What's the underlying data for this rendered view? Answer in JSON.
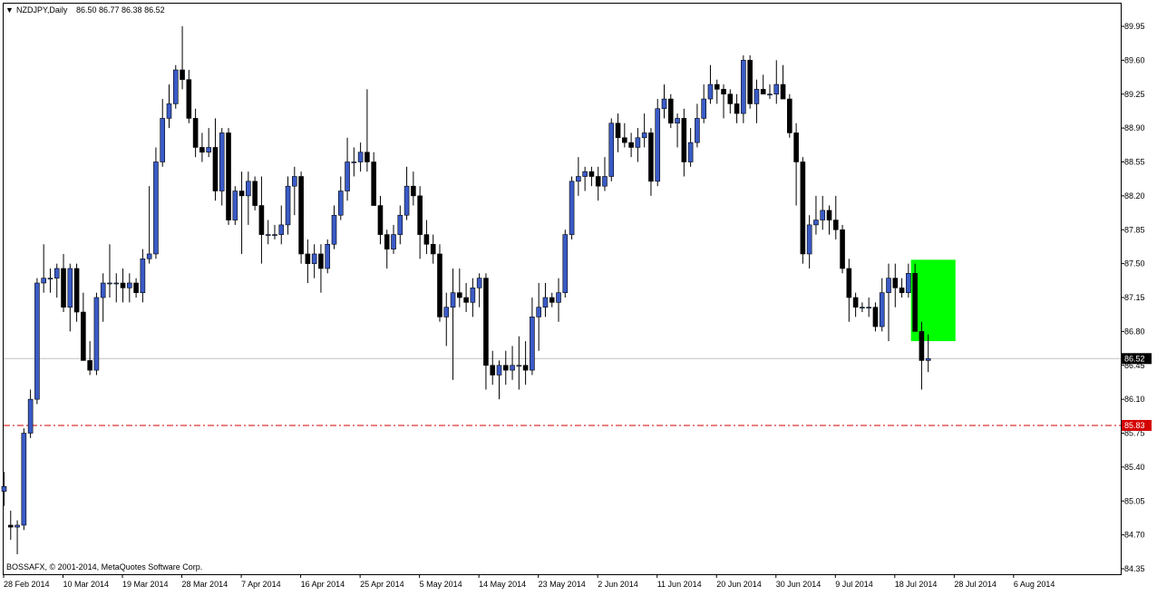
{
  "header": {
    "marker": "▼",
    "symbol_label": "NZDJPY,Daily",
    "ohlc_text": "86.50 86.77 86.38 86.52"
  },
  "footer": {
    "copyright": "BOSSAFX, © 2001-2014, MetaQuotes Software Corp."
  },
  "colors": {
    "bull": "#3a5bc7",
    "bear": "#000000",
    "support": "#d40000",
    "highlight": "#00ff00",
    "grid": "#c0c0c0"
  },
  "chart_data": {
    "type": "candlestick",
    "title": "NZDJPY,Daily",
    "ylim": [
      84.35,
      90.1
    ],
    "price_ticks": [
      "89.95",
      "89.60",
      "89.25",
      "88.90",
      "88.55",
      "88.20",
      "87.85",
      "87.50",
      "87.15",
      "86.80",
      "86.45",
      "86.10",
      "85.75",
      "85.40",
      "85.05",
      "84.70",
      "84.35"
    ],
    "date_labels": [
      "28 Feb 2014",
      "10 Mar 2014",
      "19 Mar 2014",
      "28 Mar 2014",
      "7 Apr 2014",
      "16 Apr 2014",
      "25 Apr 2014",
      "5 May 2014",
      "14 May 2014",
      "23 May 2014",
      "2 Jun 2014",
      "11 Jun 2014",
      "20 Jun 2014",
      "30 Jun 2014",
      "9 Jul 2014",
      "18 Jul 2014",
      "28 Jul 2014",
      "6 Aug 2014"
    ],
    "current_price": "86.52",
    "support_level": "85.83",
    "highlight_zone": {
      "from_candle": 138,
      "to_candle": 142,
      "price_low": 86.7,
      "price_high": 87.54
    },
    "candles": [
      [
        85.15,
        85.35,
        85.0,
        85.2
      ],
      [
        84.8,
        84.95,
        84.65,
        84.78
      ],
      [
        84.78,
        84.85,
        84.5,
        84.8
      ],
      [
        84.8,
        85.8,
        84.75,
        85.75
      ],
      [
        85.75,
        86.2,
        85.7,
        86.1
      ],
      [
        86.1,
        87.35,
        86.05,
        87.3
      ],
      [
        87.3,
        87.7,
        87.2,
        87.35
      ],
      [
        87.35,
        87.45,
        87.2,
        87.35
      ],
      [
        87.35,
        87.5,
        87.15,
        87.45
      ],
      [
        87.45,
        87.6,
        87.0,
        87.05
      ],
      [
        87.05,
        87.5,
        86.8,
        87.45
      ],
      [
        87.45,
        87.5,
        86.9,
        87.0
      ],
      [
        87.0,
        87.2,
        86.5,
        86.5
      ],
      [
        86.5,
        86.7,
        86.35,
        86.4
      ],
      [
        86.4,
        87.2,
        86.35,
        87.15
      ],
      [
        87.15,
        87.4,
        86.9,
        87.3
      ],
      [
        87.3,
        87.7,
        87.15,
        87.3
      ],
      [
        87.3,
        87.4,
        87.1,
        87.3
      ],
      [
        87.3,
        87.45,
        87.1,
        87.25
      ],
      [
        87.25,
        87.4,
        87.1,
        87.3
      ],
      [
        87.3,
        87.35,
        87.15,
        87.2
      ],
      [
        87.2,
        87.65,
        87.1,
        87.55
      ],
      [
        87.55,
        88.3,
        87.5,
        87.6
      ],
      [
        87.6,
        88.7,
        87.55,
        88.55
      ],
      [
        88.55,
        89.2,
        88.5,
        89.0
      ],
      [
        89.0,
        89.35,
        88.9,
        89.15
      ],
      [
        89.15,
        89.55,
        89.1,
        89.5
      ],
      [
        89.5,
        89.95,
        89.3,
        89.4
      ],
      [
        89.4,
        89.5,
        88.95,
        89.0
      ],
      [
        89.0,
        89.1,
        88.6,
        88.7
      ],
      [
        88.7,
        88.85,
        88.55,
        88.65
      ],
      [
        88.65,
        88.9,
        88.6,
        88.7
      ],
      [
        88.7,
        89.0,
        88.15,
        88.25
      ],
      [
        88.25,
        88.9,
        88.1,
        88.85
      ],
      [
        88.85,
        88.9,
        87.9,
        87.95
      ],
      [
        87.95,
        88.3,
        87.9,
        88.25
      ],
      [
        88.25,
        88.45,
        87.6,
        88.2
      ],
      [
        88.2,
        88.45,
        87.9,
        88.35
      ],
      [
        88.35,
        88.4,
        88.05,
        88.1
      ],
      [
        88.1,
        88.4,
        87.5,
        87.8
      ],
      [
        87.8,
        87.95,
        87.7,
        87.8
      ],
      [
        87.8,
        87.9,
        87.75,
        87.8
      ],
      [
        87.8,
        88.1,
        87.7,
        87.9
      ],
      [
        87.9,
        88.4,
        87.8,
        88.3
      ],
      [
        88.3,
        88.5,
        88.0,
        88.4
      ],
      [
        88.4,
        88.45,
        87.5,
        87.6
      ],
      [
        87.6,
        87.75,
        87.3,
        87.5
      ],
      [
        87.5,
        87.7,
        87.35,
        87.6
      ],
      [
        87.6,
        87.7,
        87.2,
        87.45
      ],
      [
        87.45,
        87.75,
        87.4,
        87.7
      ],
      [
        87.7,
        88.1,
        87.65,
        88.0
      ],
      [
        88.0,
        88.4,
        87.95,
        88.25
      ],
      [
        88.25,
        88.8,
        88.15,
        88.55
      ],
      [
        88.55,
        88.7,
        88.4,
        88.55
      ],
      [
        88.55,
        88.75,
        88.45,
        88.65
      ],
      [
        88.65,
        89.3,
        88.45,
        88.55
      ],
      [
        88.55,
        88.65,
        88.1,
        88.1
      ],
      [
        88.1,
        88.2,
        87.7,
        87.8
      ],
      [
        87.8,
        87.85,
        87.45,
        87.65
      ],
      [
        87.65,
        87.9,
        87.6,
        87.8
      ],
      [
        87.8,
        88.1,
        87.7,
        88.0
      ],
      [
        88.0,
        88.5,
        87.95,
        88.3
      ],
      [
        88.3,
        88.45,
        88.1,
        88.2
      ],
      [
        88.2,
        88.3,
        87.55,
        87.8
      ],
      [
        87.8,
        87.95,
        87.6,
        87.7
      ],
      [
        87.7,
        87.8,
        87.5,
        87.6
      ],
      [
        87.6,
        87.7,
        86.9,
        86.95
      ],
      [
        86.95,
        87.2,
        86.65,
        87.05
      ],
      [
        87.05,
        87.45,
        86.3,
        87.2
      ],
      [
        87.2,
        87.45,
        87.05,
        87.15
      ],
      [
        87.15,
        87.3,
        87.0,
        87.1
      ],
      [
        87.1,
        87.35,
        86.95,
        87.25
      ],
      [
        87.25,
        87.4,
        87.05,
        87.35
      ],
      [
        87.35,
        87.4,
        86.2,
        86.45
      ],
      [
        86.45,
        86.6,
        86.25,
        86.35
      ],
      [
        86.35,
        86.5,
        86.1,
        86.45
      ],
      [
        86.45,
        86.6,
        86.25,
        86.4
      ],
      [
        86.4,
        86.65,
        86.3,
        86.45
      ],
      [
        86.45,
        86.75,
        86.2,
        86.45
      ],
      [
        86.45,
        86.7,
        86.25,
        86.4
      ],
      [
        86.4,
        87.15,
        86.35,
        86.95
      ],
      [
        86.95,
        87.3,
        86.6,
        87.05
      ],
      [
        87.05,
        87.3,
        86.95,
        87.15
      ],
      [
        87.15,
        87.2,
        87.05,
        87.1
      ],
      [
        87.1,
        87.35,
        86.9,
        87.2
      ],
      [
        87.2,
        87.85,
        87.15,
        87.8
      ],
      [
        87.8,
        88.4,
        87.75,
        88.35
      ],
      [
        88.35,
        88.6,
        88.2,
        88.4
      ],
      [
        88.4,
        88.5,
        88.25,
        88.45
      ],
      [
        88.45,
        88.5,
        88.3,
        88.4
      ],
      [
        88.4,
        88.5,
        88.15,
        88.3
      ],
      [
        88.3,
        88.6,
        88.25,
        88.4
      ],
      [
        88.4,
        89.0,
        88.35,
        88.95
      ],
      [
        88.95,
        89.05,
        88.65,
        88.8
      ],
      [
        88.8,
        88.95,
        88.7,
        88.75
      ],
      [
        88.75,
        88.85,
        88.6,
        88.7
      ],
      [
        88.7,
        88.9,
        88.55,
        88.8
      ],
      [
        88.8,
        89.05,
        88.7,
        88.85
      ],
      [
        88.85,
        88.9,
        88.2,
        88.35
      ],
      [
        88.35,
        89.2,
        88.3,
        89.1
      ],
      [
        89.1,
        89.35,
        89.0,
        89.2
      ],
      [
        89.2,
        89.25,
        88.9,
        88.95
      ],
      [
        88.95,
        89.05,
        88.7,
        89.0
      ],
      [
        89.0,
        89.1,
        88.4,
        88.55
      ],
      [
        88.55,
        88.9,
        88.5,
        88.75
      ],
      [
        88.75,
        89.15,
        88.7,
        89.0
      ],
      [
        89.0,
        89.35,
        88.95,
        89.2
      ],
      [
        89.2,
        89.55,
        89.15,
        89.35
      ],
      [
        89.35,
        89.4,
        89.15,
        89.3
      ],
      [
        89.3,
        89.35,
        89.0,
        89.25
      ],
      [
        89.25,
        89.3,
        89.05,
        89.15
      ],
      [
        89.15,
        89.25,
        88.95,
        89.05
      ],
      [
        89.05,
        89.65,
        88.95,
        89.6
      ],
      [
        89.6,
        89.65,
        89.1,
        89.15
      ],
      [
        89.15,
        89.4,
        88.95,
        89.3
      ],
      [
        89.3,
        89.45,
        89.25,
        89.25
      ],
      [
        89.25,
        89.35,
        89.2,
        89.25
      ],
      [
        89.25,
        89.6,
        89.15,
        89.35
      ],
      [
        89.35,
        89.55,
        89.2,
        89.2
      ],
      [
        89.2,
        89.25,
        88.8,
        88.85
      ],
      [
        88.85,
        88.95,
        88.1,
        88.55
      ],
      [
        88.55,
        88.6,
        87.5,
        87.6
      ],
      [
        87.6,
        88.0,
        87.45,
        87.9
      ],
      [
        87.9,
        88.2,
        87.8,
        87.95
      ],
      [
        87.95,
        88.2,
        87.85,
        88.05
      ],
      [
        88.05,
        88.1,
        87.8,
        87.95
      ],
      [
        87.95,
        88.2,
        87.75,
        87.85
      ],
      [
        87.85,
        87.9,
        87.4,
        87.45
      ],
      [
        87.45,
        87.55,
        86.9,
        87.15
      ],
      [
        87.15,
        87.2,
        86.95,
        87.05
      ],
      [
        87.05,
        87.1,
        87.0,
        87.05
      ],
      [
        87.05,
        87.15,
        86.95,
        87.05
      ],
      [
        87.05,
        87.1,
        86.8,
        86.85
      ],
      [
        86.85,
        87.35,
        86.8,
        87.2
      ],
      [
        87.2,
        87.5,
        86.7,
        87.35
      ],
      [
        87.35,
        87.5,
        87.05,
        87.25
      ],
      [
        87.25,
        87.35,
        87.15,
        87.2
      ],
      [
        87.2,
        87.5,
        87.15,
        87.4
      ],
      [
        87.4,
        87.5,
        86.8,
        86.8
      ],
      [
        86.8,
        86.9,
        86.2,
        86.5
      ],
      [
        86.5,
        86.77,
        86.38,
        86.52
      ]
    ]
  }
}
